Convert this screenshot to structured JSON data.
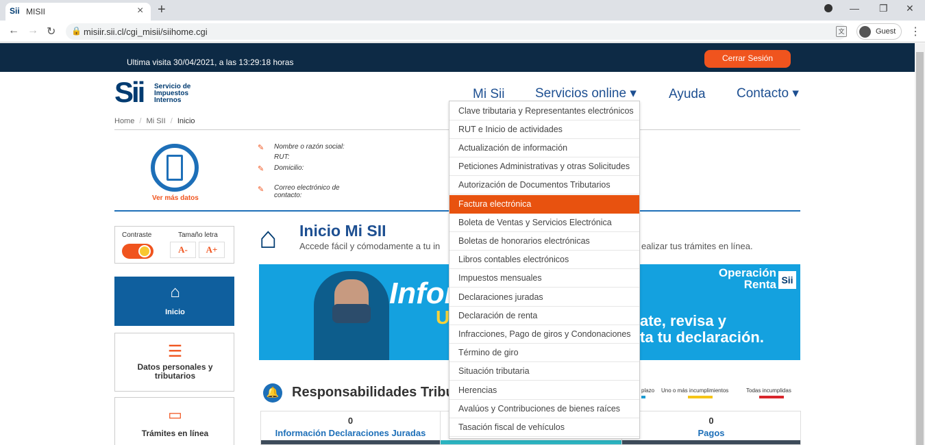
{
  "browser": {
    "tab_title": "MISII",
    "favicon": "Sii",
    "url": "misiir.sii.cl/cgi_misii/siihome.cgi",
    "profile_label": "Guest"
  },
  "header": {
    "last_visit": "Ultima visita 30/04/2021, a las 13:29:18 horas",
    "logout_label": "Cerrar Sesión"
  },
  "logo": {
    "mark": "Sii",
    "line1": "Servicio de",
    "line2": "Impuestos",
    "line3": "Internos"
  },
  "nav": {
    "mi_sii": "Mi Sii",
    "servicios": "Servicios online ▾",
    "ayuda": "Ayuda",
    "contacto": "Contacto ▾"
  },
  "breadcrumb": {
    "home": "Home",
    "misii": "Mi SII",
    "current": "Inicio",
    "sep": "/"
  },
  "profile": {
    "ver_mas": "Ver más datos",
    "nombre": "Nombre o razón social:",
    "rut": "RUT:",
    "domicilio": "Domicilio:",
    "correo1": "Correo electrónico de",
    "correo2": "contacto:"
  },
  "accessibility": {
    "contraste": "Contraste",
    "tamano": "Tamaño letra",
    "minus": "A-",
    "plus": "A+"
  },
  "left_nav": [
    {
      "label": "Inicio",
      "icon": "house-icon"
    },
    {
      "label": "Datos personales y tributarios",
      "icon": "id-card-icon"
    },
    {
      "label": "Trámites en línea",
      "icon": "monitor-icon"
    }
  ],
  "hero": {
    "title": "Inicio Mi SII",
    "subtitle": "Accede fácil y cómodamente a tu in",
    "subtitle_tail": "ealizar tus trámites en línea."
  },
  "banner": {
    "big_text": "Infor",
    "sub_text": "U",
    "operacion": "Operación Renta",
    "sii": "Sii",
    "tag1": "ate, revisa y",
    "tag2": "ta tu declaración."
  },
  "responsabilidades": {
    "title": "Responsabilidades Tribut",
    "legend": [
      {
        "label": "plazo",
        "color": "#1d9bd1"
      },
      {
        "label": "Uno o más incumplimientos",
        "color": "#f5c518"
      },
      {
        "label": "Todas incumplidas",
        "color": "#d9262c"
      }
    ],
    "cards": [
      {
        "count": "0",
        "label": "Información Declaraciones Juradas"
      },
      {
        "count": "0",
        "label": "Pagos"
      }
    ]
  },
  "dropdown": {
    "items": [
      "Clave tributaria y Representantes electrónicos",
      "RUT e Inicio de actividades",
      "Actualización de información",
      "Peticiones Administrativas y otras Solicitudes",
      "Autorización de Documentos Tributarios",
      "Factura electrónica",
      "Boleta de Ventas y Servicios Electrónica",
      "Boletas de honorarios electrónicas",
      "Libros contables electrónicos",
      "Impuestos mensuales",
      "Declaraciones juradas",
      "Declaración de renta",
      "Infracciones, Pago de giros y Condonaciones",
      "Término de giro",
      "Situación tributaria",
      "Herencias",
      "Avalúos y Contribuciones de bienes raíces",
      "Tasación fiscal de vehículos"
    ],
    "active_index": 5
  },
  "colors": {
    "accent": "#f0541e",
    "navy": "#0d2a45",
    "brand_blue": "#1d4f91"
  }
}
